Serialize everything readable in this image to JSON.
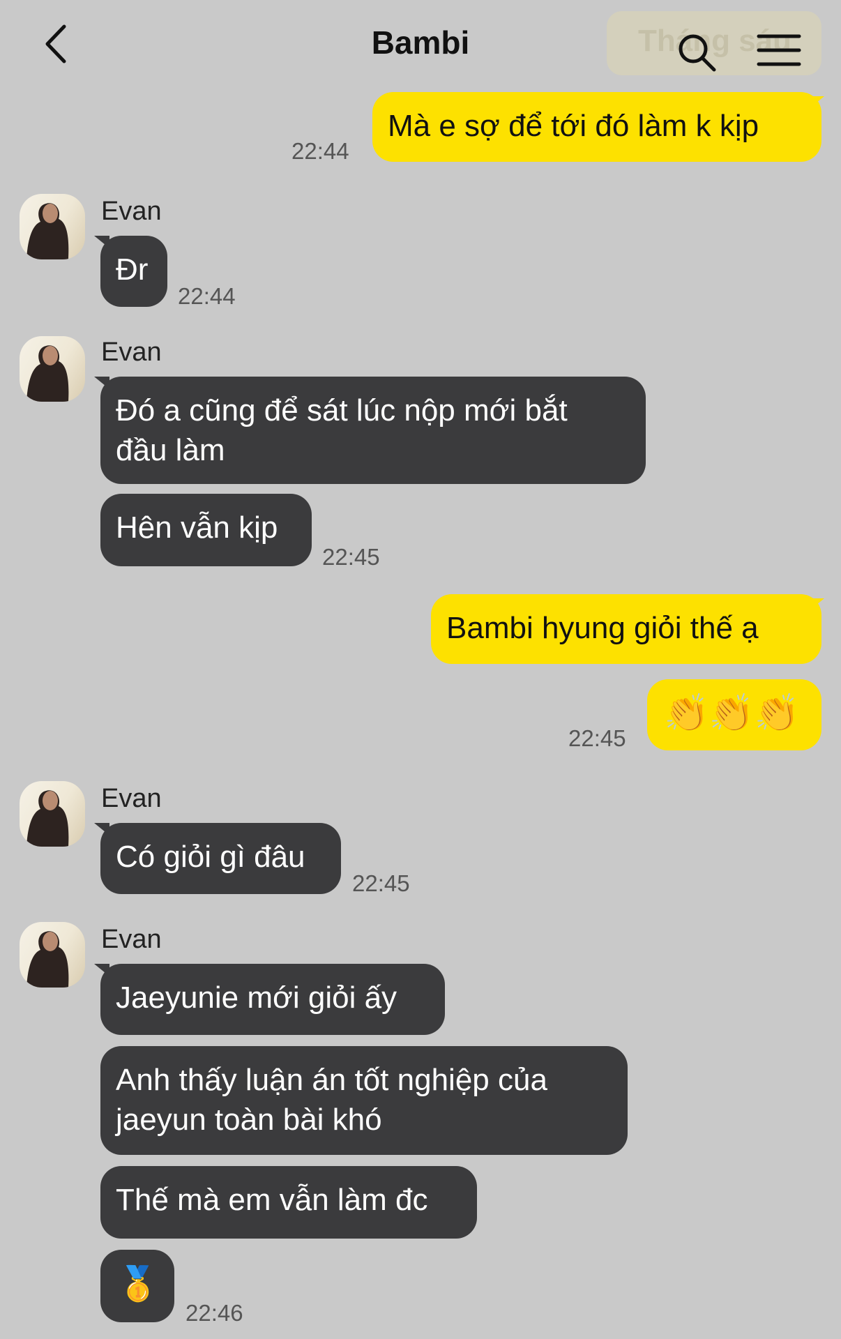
{
  "header": {
    "title": "Bambi",
    "month_label": "Tháng sáu"
  },
  "messages": [
    {
      "text": "Mà e sợ để tới đó làm k kịp",
      "time": "22:44"
    },
    {
      "sender": "Evan",
      "text": "Đr",
      "time": "22:44"
    },
    {
      "sender": "Evan",
      "text": "Đó a cũng để sát lúc nộp mới bắt",
      "text2": "đầu làm"
    },
    {
      "text": "Hên vẫn kịp",
      "time": "22:45"
    },
    {
      "text": "Bambi hyung giỏi thế ạ"
    },
    {
      "emoji": "👏👏👏",
      "time": "22:45"
    },
    {
      "sender": "Evan",
      "text": "Có giỏi gì đâu",
      "time": "22:45"
    },
    {
      "sender": "Evan",
      "text": "Jaeyunie mới giỏi ấy"
    },
    {
      "text": "Anh thấy luận án tốt nghiệp của",
      "text2": "jaeyun toàn bài khó"
    },
    {
      "text": "Thế mà em vẫn làm đc"
    },
    {
      "emoji": "🥇",
      "time": "22:46"
    }
  ]
}
